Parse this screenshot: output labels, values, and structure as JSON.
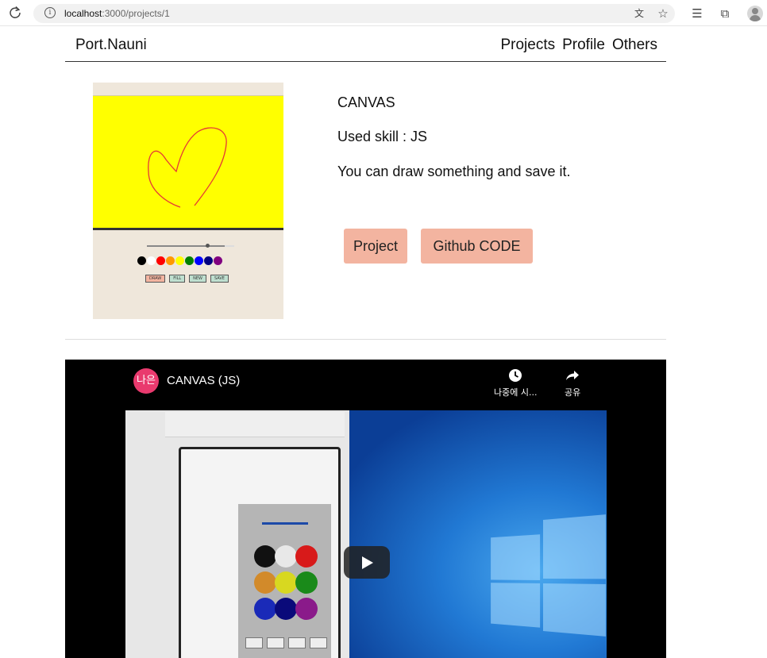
{
  "browser": {
    "url_host": "localhost",
    "url_path": ":3000/projects/1",
    "icons": [
      "reload-icon",
      "info-icon",
      "translate-icon",
      "star-icon",
      "favorites-icon",
      "collections-icon",
      "profile-icon"
    ]
  },
  "header": {
    "brand": "Port.Nauni",
    "nav": [
      "Projects",
      "Profile",
      "Others"
    ]
  },
  "project": {
    "title": "CANVAS",
    "skill": "Used skill : JS",
    "description": "You can draw something and save it.",
    "buttons": {
      "project": "Project",
      "github": "Github CODE"
    },
    "thumbnail": {
      "canvas_color": "#ffff00",
      "stroke_color": "#e53935",
      "palette": [
        "#000000",
        "#ffffff",
        "#ff0000",
        "#ff9800",
        "#ffff00",
        "#008000",
        "#0000ff",
        "#000080",
        "#800080"
      ],
      "buttons": [
        "DRAW",
        "FILL",
        "NEW",
        "SAVE"
      ]
    },
    "accent_color": "#f3b4a0"
  },
  "video": {
    "channel_avatar": "나은",
    "title": "CANVAS (JS)",
    "watch_later": "나중에 시...",
    "share": "공유",
    "dot_colors": [
      "#111111",
      "#e8e8e8",
      "#d81a1a",
      "#d28a2a",
      "#d8d820",
      "#1a8a1a",
      "#1a2ab8",
      "#0a0a7a",
      "#8a1a8a"
    ]
  }
}
